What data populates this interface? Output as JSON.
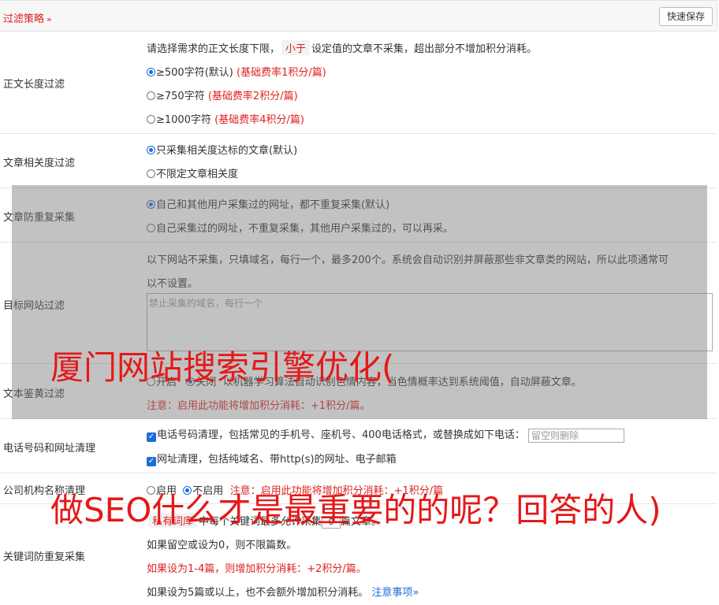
{
  "header": {
    "title": "过滤策略",
    "chevron": "»",
    "save_label": "快速保存"
  },
  "length_filter": {
    "label": "正文长度过滤",
    "desc_before": "请选择需求的正文长度下限，",
    "desc_pill": "小于",
    "desc_after": "设定值的文章不采集，超出部分不增加积分消耗。",
    "options": [
      {
        "text": "≥500字符(默认)",
        "note": "(基础费率1积分/篇)",
        "selected": true
      },
      {
        "text": "≥750字符",
        "note": "(基础费率2积分/篇)",
        "selected": false
      },
      {
        "text": "≥1000字符",
        "note": "(基础费率4积分/篇)",
        "selected": false
      }
    ]
  },
  "relevance_filter": {
    "label": "文章相关度过滤",
    "options": [
      {
        "text": "只采集相关度达标的文章(默认)",
        "selected": true
      },
      {
        "text": "不限定文章相关度",
        "selected": false
      }
    ]
  },
  "dedup_filter": {
    "label": "文章防重复采集",
    "options": [
      {
        "text": "自己和其他用户采集过的网址，都不重复采集(默认)",
        "selected": true
      },
      {
        "text": "自己采集过的网址，不重复采集，其他用户采集过的，可以再采。",
        "selected": false
      }
    ]
  },
  "site_filter": {
    "label": "目标网站过滤",
    "desc_line1": "以下网站不采集，只填域名，每行一个，最多200个。系统会自动识别并屏蔽那些非文章类的网站，所以此项通常可",
    "desc_line2": "以不设置。",
    "placeholder": "禁止采集的域名，每行一个"
  },
  "porn_filter": {
    "label": "文本鉴黄过滤",
    "on_label": "开启",
    "off_label": "关闭",
    "desc": "以机器学习算法自动识别色情内容，当色情概率达到系统阈值，自动屏蔽文章。",
    "warning": "注意：启用此功能将增加积分消耗：+1积分/篇。"
  },
  "phone_filter": {
    "label": "电话号码和网址清理",
    "phone_text": "电话号码清理，包括常见的手机号、座机号、400电话格式，或替换成如下电话：",
    "phone_placeholder": "留空则删除",
    "url_text": "网址清理，包括纯域名、带http(s)的网址、电子邮箱"
  },
  "org_filter": {
    "label": "公司机构名称清理",
    "on_label": "启用",
    "off_label": "不启用",
    "warning": "注意：启用此功能将增加积分消耗：+1积分/篇"
  },
  "keyword_filter": {
    "label": "关键词防重复采集",
    "pill": "私有词库",
    "line1_before": "中每个关键词最多允许采集",
    "value": "0",
    "line1_after": "篇文章。",
    "line2": "如果留空或设为0，则不限篇数。",
    "line3": "如果设为1-4篇，则增加积分消耗：+2积分/篇。",
    "line4": "如果设为5篇或以上，也不会额外增加积分消耗。",
    "link": "注意事项",
    "link_chevron": "»"
  },
  "watermarks": {
    "line1": "厦门网站搜索引擎优化(",
    "line2": "做SEO什么才是最重要的的呢？回答的人)"
  }
}
